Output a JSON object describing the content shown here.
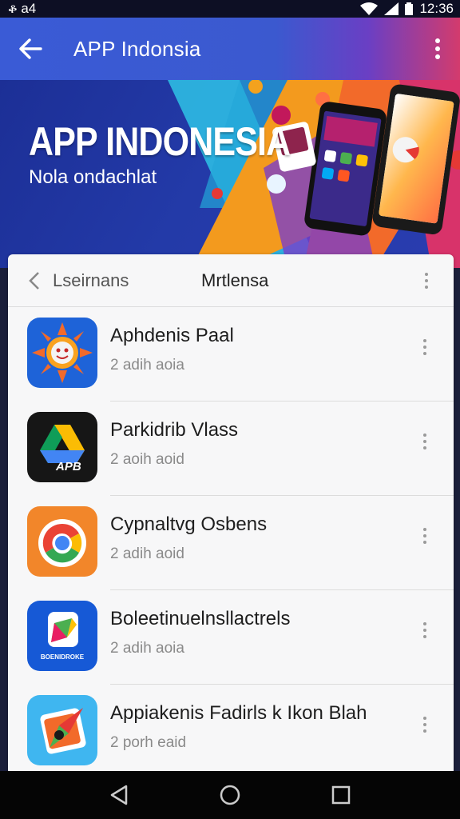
{
  "status_bar": {
    "left_text": "ቆ a4",
    "time": "12:36"
  },
  "app_bar": {
    "title": "APP Indonsia"
  },
  "banner": {
    "title": "APP INDONESIA",
    "subtitle": "Nola ondachlat"
  },
  "list_header": {
    "tab_left": "Lseirnans",
    "tab_right": "Mrtlensa"
  },
  "apps": [
    {
      "name": "Aphdenis Paal",
      "meta": "2 adih aoia"
    },
    {
      "name": "Parkidrib Vlass",
      "meta": "2 aoih aoid"
    },
    {
      "name": "Cypnaltvg Osbens",
      "meta": "2 adih aoid"
    },
    {
      "name": "Boleetinuelnsllactrels",
      "meta": "2 adih aoia"
    },
    {
      "name": "Appiakenis Fadirls k Ikon Blah",
      "meta": "2 porh eaid"
    }
  ],
  "icon_labels": {
    "app2": "APB",
    "app4": "BOENIDROKE"
  },
  "colors": {
    "app_bar": "#3a5bd6",
    "banner_bg": "#1c2f96",
    "accent_orange": "#f39a1e"
  }
}
